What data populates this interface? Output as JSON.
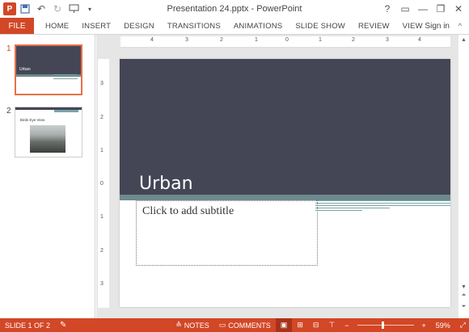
{
  "window": {
    "title": "Presentation 24.pptx - PowerPoint",
    "help": "?",
    "controls": {
      "ribbon_display": "▭",
      "minimize": "—",
      "restore": "❐",
      "close": "✕"
    }
  },
  "qat": {
    "logo_text": "P",
    "save_icon": "save-icon",
    "undo_icon": "undo-icon",
    "redo_icon": "redo-icon",
    "presenter_icon": "start-from-beginning-icon",
    "customize_icon": "customize-qat-icon"
  },
  "ribbon": {
    "file_label": "FILE",
    "tabs": [
      "HOME",
      "INSERT",
      "DESIGN",
      "TRANSITIONS",
      "ANIMATIONS",
      "SLIDE SHOW",
      "REVIEW",
      "VIEW"
    ],
    "sign_in": "Sign in"
  },
  "slide_pane": {
    "thumbnails": [
      {
        "number": "1",
        "title": "Urban"
      },
      {
        "number": "2",
        "heading": "Birds Eye View"
      }
    ]
  },
  "rulers": {
    "horizontal": [
      "4",
      "3",
      "2",
      "1",
      "0",
      "1",
      "2",
      "3",
      "4"
    ],
    "vertical": [
      "3",
      "2",
      "1",
      "0",
      "1",
      "2",
      "3"
    ]
  },
  "slide": {
    "title": "Urban",
    "subtitle_placeholder": "Click to add subtitle",
    "colors": {
      "header": "#444656",
      "band": "#6d8a8c",
      "lines": "#7aa5a8"
    }
  },
  "statusbar": {
    "slide_indicator": "SLIDE 1 OF 2",
    "notes_label": "NOTES",
    "comments_label": "COMMENTS",
    "zoom": "59%",
    "zoom_value": 59,
    "accent": "#d24726"
  }
}
